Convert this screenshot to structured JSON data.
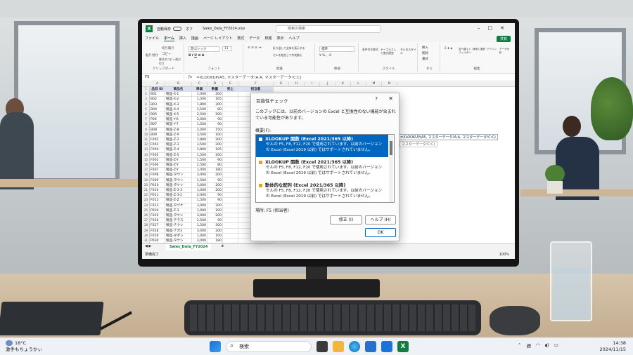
{
  "excel": {
    "autosave_label": "自動保存",
    "autosave_state": "オフ",
    "file_name": "Sales_Data_FY2024.xlsx",
    "search_placeholder": "検索の検索",
    "menu_tabs": [
      "ファイル",
      "ホーム",
      "挿入",
      "描画",
      "ページ レイアウト",
      "数式",
      "データ",
      "校閲",
      "表示",
      "ヘルプ"
    ],
    "share_label": "共有",
    "ribbon_groups": [
      "クリップボード",
      "フォント",
      "配置",
      "数値",
      "スタイル",
      "セル",
      "編集"
    ],
    "ribbon_items": {
      "paste": "貼り付け",
      "cut": "切り取り",
      "copy": "コピー",
      "format_painter": "書式のコピー/貼り付け",
      "font_name": "游ゴシック",
      "font_size": "11",
      "wrap": "折り返して全体を表示する",
      "merge": "セルを結合して中央揃え",
      "number_format": "標準",
      "conditional": "条件付き書式",
      "table_format": "テーブルとして書式設定",
      "cell_styles": "セルのスタイル",
      "insert": "挿入",
      "delete": "削除",
      "format": "書式",
      "sort": "並べ替えとフィルター",
      "find": "検索と選択",
      "addins": "アドイン",
      "analyze": "データ分析"
    },
    "name_box": "F5",
    "formula": "=XLOOKUP(A5, マスターデータ!A:A, マスターデータ!C:C)",
    "columns": [
      "A",
      "B",
      "C",
      "D",
      "E",
      "F",
      "G",
      "H",
      "I",
      "J",
      "K",
      "L",
      "M",
      "N"
    ],
    "table_headers": [
      "品目 ID",
      "商品名",
      "単価",
      "数量",
      "売上",
      "担当者"
    ],
    "rows": [
      [
        "B01",
        "製品-X-1",
        "1,000",
        "200"
      ],
      [
        "B02",
        "製品-X-2",
        "1,500",
        "165"
      ],
      [
        "B03",
        "製品-X-3",
        "1,800",
        "200"
      ],
      [
        "B04",
        "製品-X-4",
        "2,500",
        "80"
      ],
      [
        "B05",
        "製品-X-5",
        "2,500",
        "200"
      ],
      [
        "P06",
        "製品-Y-6",
        "2,000",
        "90"
      ],
      [
        "B07",
        "製品-Y-7",
        "1,500",
        "90"
      ],
      [
        "B08",
        "製品-Z-8",
        "2,000",
        "150"
      ],
      [
        "B09",
        "製品-Z-9",
        "3,500",
        "100"
      ],
      [
        "F002",
        "製品-Z-2",
        "1,800",
        "200"
      ],
      [
        "F003",
        "製品-Z-3",
        "3,500",
        "200"
      ],
      [
        "F004",
        "製品-Z-4",
        "2,800",
        "105"
      ],
      [
        "F005",
        "製品-Z-5",
        "1,500",
        "200"
      ],
      [
        "F002",
        "製品-Z-Y",
        "1,500",
        "90"
      ],
      [
        "F006",
        "製品-Z-Y",
        "2,500",
        "80"
      ],
      [
        "F007",
        "製品-Z-Y",
        "1,000",
        "180"
      ],
      [
        "F008",
        "製品-タウン",
        "3,000",
        "200"
      ],
      [
        "F009",
        "製品-タウン",
        "1,500",
        "90"
      ],
      [
        "P010",
        "製品-タケシ",
        "3,000",
        "200"
      ],
      [
        "F010",
        "製品-Z-3-3",
        "1,000",
        "200"
      ],
      [
        "P011",
        "製品-Z-3-2",
        "2,000",
        "90"
      ],
      [
        "F012",
        "製品-Z-Z",
        "1,500",
        "90"
      ],
      [
        "F013",
        "製品-タヅケ",
        "3,000",
        "200"
      ],
      [
        "P034",
        "製品-Z-3",
        "1,000",
        "100"
      ],
      [
        "F026",
        "製品-タケシ",
        "3,000",
        "200"
      ],
      [
        "F026",
        "製品-テラス",
        "2,500",
        "90"
      ],
      [
        "F027",
        "製品-テクシ",
        "1,500",
        "200"
      ],
      [
        "F028",
        "製品-テガ3",
        "3,000",
        "200"
      ],
      [
        "F029",
        "製品-ダダシ",
        "1,000",
        "100"
      ],
      [
        "P030",
        "製品-タケシ",
        "3,000",
        "180"
      ]
    ],
    "spill_formula": "=XLOOKUP(A5, マスターデータ!A:A, マスターデータ!C:C)",
    "spill_hint": "マスターデータ!C:C)",
    "sheet_tab": "Sales_Data_FY2024",
    "status_text": "準備完了",
    "zoom": "100%"
  },
  "dialog": {
    "title": "互換性チェック",
    "help_glyph": "?",
    "message": "このブックには、以前のバージョンの Excel と互換性のない機能が含まれている可能性があります。",
    "summary_label": "概要(F):",
    "issues": [
      {
        "title": "XLOOKUP 関数 (Excel 2021/365 以降)",
        "body": "セルの F5, F8, F12, F20 で使用されています。以前のバージョンの Excel (Excel 2019 以前) ではサポートされていません。",
        "color": "#ffffff"
      },
      {
        "title": "XLOOKUP 関数 (Excel 2021/365 以降)",
        "body": "セルの F5, F8, F12, F20 で使用されています。以前のバージョンの Excel (Excel 2019 以前) ではサポートされていません。",
        "color": "#e8a317"
      },
      {
        "title": "動体的な配列 (Excel 2021/365 以降)",
        "body": "セルの F5, F8, F12, F20 で使用されています。以前のバージョンの Excel (Excel 2019 以前) ではサポートされていません。",
        "color": "#e8a317"
      }
    ],
    "location_label": "場所: F5 (担当者)",
    "fix_button": "修正 (I)",
    "help_button": "ヘルプ (H)",
    "ok_button": "OK"
  },
  "taskbar": {
    "weather_temp": "18°C",
    "weather_text": "激手もちょうかぃ",
    "search_placeholder": "検索",
    "tray_lang": "週",
    "time": "14:38",
    "date": "2024/11/15"
  },
  "colors": {
    "excel_green": "#107c41",
    "selection_blue": "#0067c0",
    "table_header": "#d9e1f2"
  }
}
